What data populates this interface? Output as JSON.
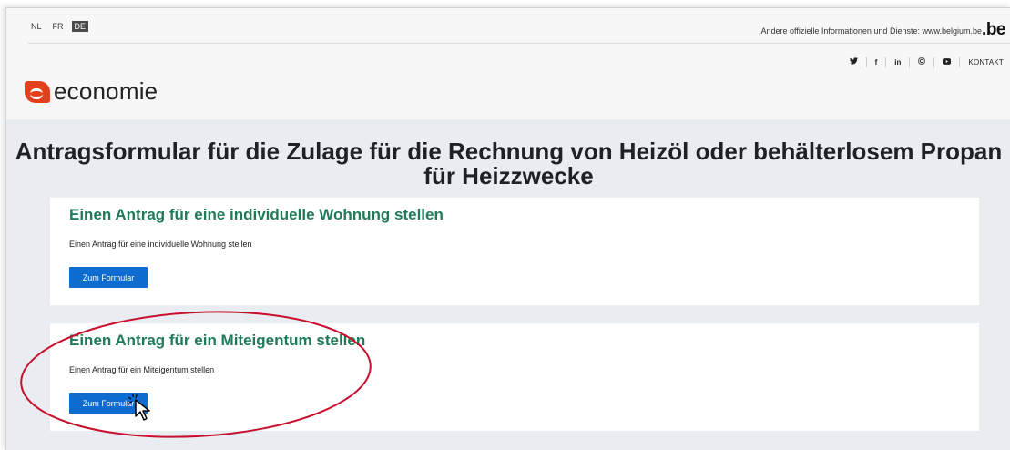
{
  "header": {
    "languages": [
      "NL",
      "FR",
      "DE"
    ],
    "official_text": "Andere offizielle Informationen und Dienste: www.belgium.be",
    "be_logo": ".be",
    "social_icons": [
      "twitter-icon",
      "facebook-icon",
      "linkedin-icon",
      "instagram-icon",
      "youtube-icon"
    ],
    "social_glyphs": [
      "𝕪",
      "f",
      "in",
      "◎",
      "▶"
    ],
    "contact_label": "KONTAKT",
    "logo_text": "economie"
  },
  "main": {
    "title": "Antragsformular für die Zulage für die Rechnung von Heizöl oder behälterlosem Propan für Heizzwecke",
    "cards": [
      {
        "heading": "Einen Antrag für eine individuelle Wohnung stellen",
        "text": "Einen Antrag für eine individuelle Wohnung stellen",
        "button": "Zum Formular"
      },
      {
        "heading": "Einen Antrag für ein Miteigentum stellen",
        "text": "Einen Antrag für ein Miteigentum stellen",
        "button": "Zum Formular"
      }
    ]
  },
  "colors": {
    "accent_green": "#1f7a57",
    "button_blue": "#0e6bcf",
    "annotation_red": "#c8102e",
    "logo_orange": "#e2401c"
  }
}
